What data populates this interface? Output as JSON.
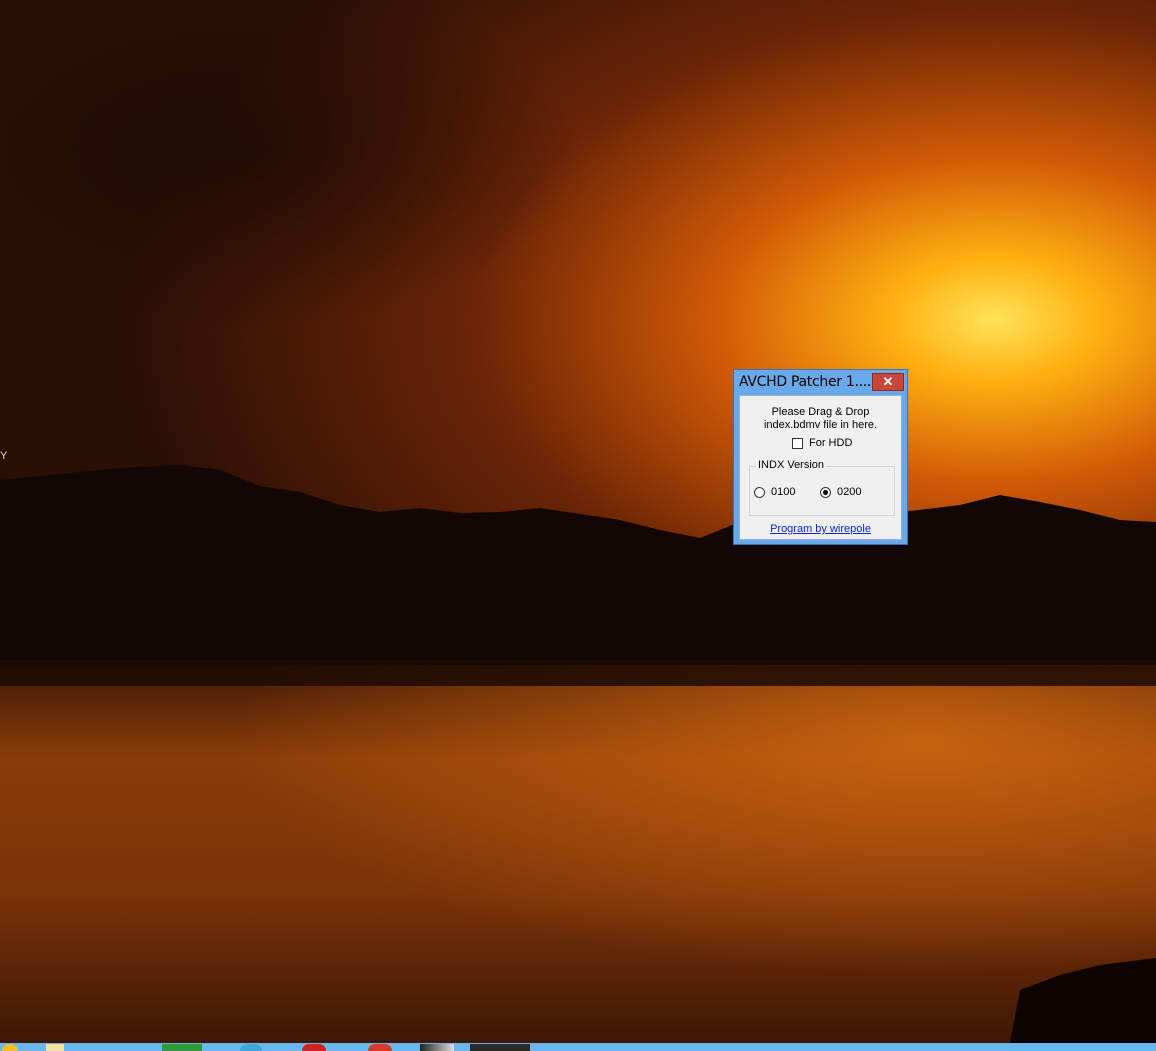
{
  "window": {
    "title": "AVCHD Patcher 1....",
    "close_glyph": "✕"
  },
  "dialog": {
    "instruction_line1": "Please Drag & Drop",
    "instruction_line2": "index.bdmv file in here.",
    "hdd_checkbox_label": "For HDD",
    "hdd_checked": false,
    "group_label": "INDX Version",
    "radio_options": [
      {
        "label": "0100",
        "checked": false
      },
      {
        "label": "0200",
        "checked": true
      }
    ],
    "credit_link": "Program by wirepole"
  },
  "desktop": {
    "stray_text": "Y",
    "wallpaper": "sunset-lake"
  },
  "taskbar": {
    "color": "#6ab7ee"
  },
  "colors": {
    "titlebar": "#6aa9e9",
    "close_button": "#c7473a",
    "link": "#0a24d6"
  }
}
